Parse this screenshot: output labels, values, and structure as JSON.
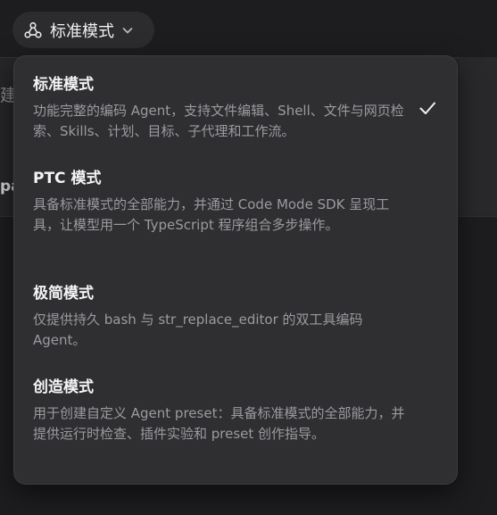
{
  "mode_selector": {
    "label": "标准模式",
    "icon": "agent-nodes-icon",
    "chevron": "chevron-down-icon"
  },
  "background": {
    "partial_text_1": "建",
    "partial_text_2": "pa"
  },
  "dropdown": {
    "options": [
      {
        "title": "标准模式",
        "description": "功能完整的编码 Agent，支持文件编辑、Shell、文件与网页检索、Skills、计划、目标、子代理和工作流。",
        "selected": true
      },
      {
        "title": "PTC 模式",
        "description": "具备标准模式的全部能力，并通过 Code Mode SDK 呈现工具，让模型用一个 TypeScript 程序组合多步操作。",
        "selected": false
      },
      {
        "title": "极简模式",
        "description": "仅提供持久 bash 与 str_replace_editor 的双工具编码 Agent。",
        "selected": false
      },
      {
        "title": "创造模式",
        "description": "用于创建自定义 Agent preset：具备标准模式的全部能力，并提供运行时检查、插件实验和 preset 创作指导。",
        "selected": false
      }
    ]
  },
  "colors": {
    "page_background": "#1d1d1f",
    "panel_background": "#2f2f32",
    "title_text": "#f4f4f6",
    "description_text": "#9a9aa0"
  }
}
